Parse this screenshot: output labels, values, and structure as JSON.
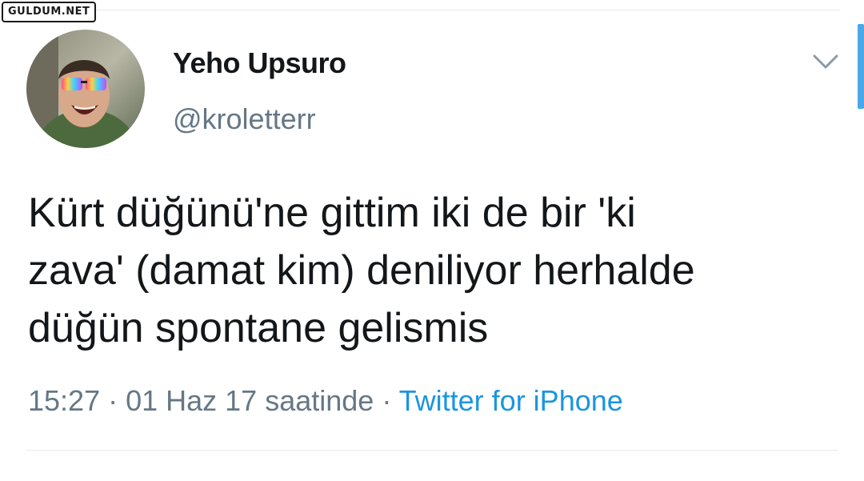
{
  "watermark": {
    "text": "GULDUM.NET"
  },
  "tweet": {
    "author": {
      "display_name": "Yeho Upsuro",
      "handle": "@kroletterr",
      "avatar": "avatar-photo-with-rainbow-sunglasses"
    },
    "text_lines": [
      "Kürt düğünü'ne gittim iki de bir 'ki",
      "zava' (damat kim) deniliyor herhalde",
      "düğün spontane gelismis"
    ],
    "meta": {
      "time": "15:27",
      "separator": " · ",
      "date": "01 Haz 17 saatinde",
      "source": "Twitter for iPhone"
    },
    "menu_icon": "chevron-down-icon"
  },
  "colors": {
    "text": "#14171a",
    "secondary": "#657786",
    "link": "#1b95e0",
    "divider": "#e6ecf0",
    "scroll_indicator": "#4aa8e8"
  }
}
